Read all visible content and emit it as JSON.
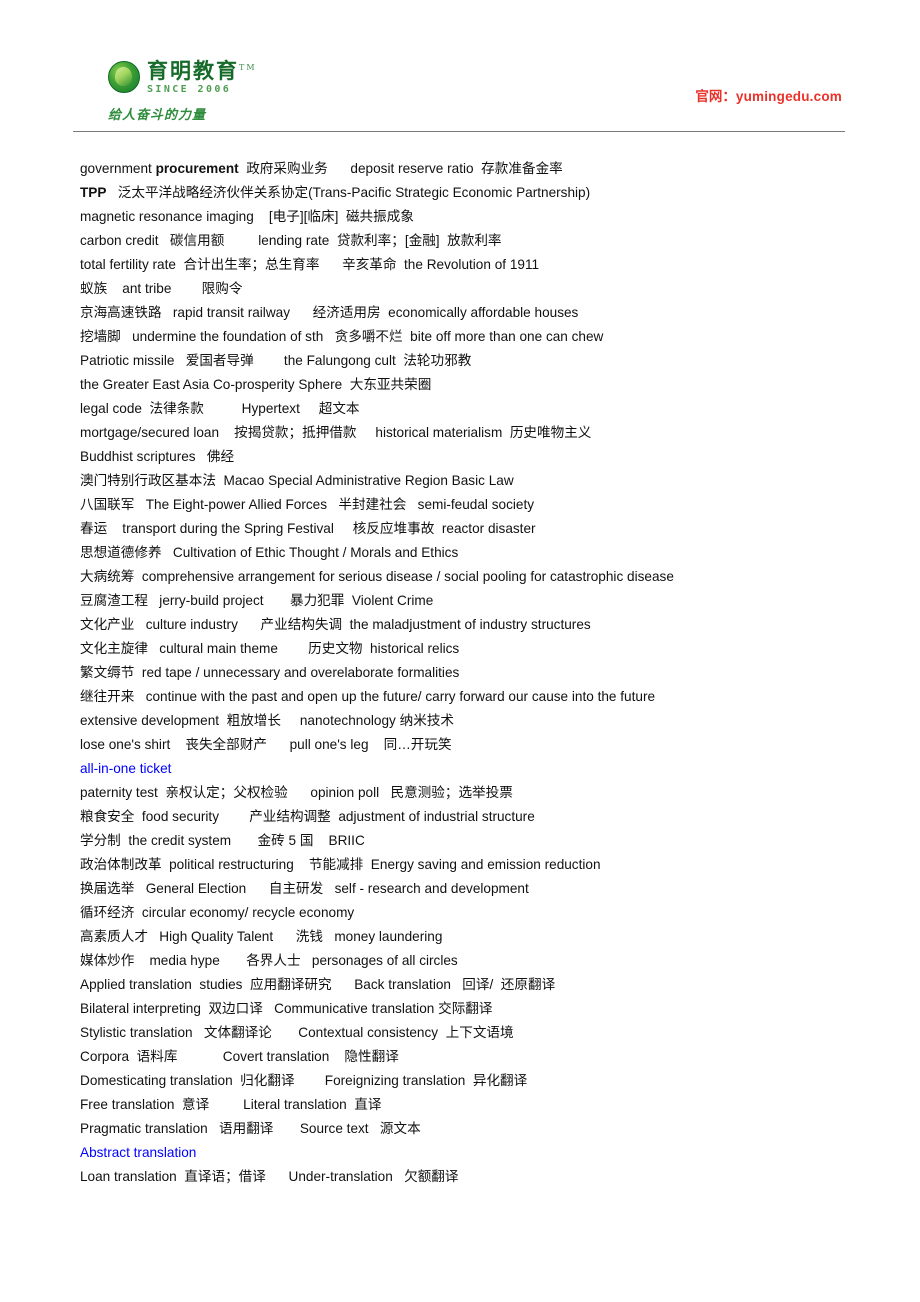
{
  "header": {
    "logo": {
      "brand_cn": "育明教育",
      "trademark": "TM",
      "since": "SINCE 2006",
      "slogan": "给人奋斗的力量"
    },
    "site_label": "官网：",
    "site_url": "yumingedu.com",
    "url_color": "#e8322a",
    "brand_color": "#176b2a"
  },
  "document": {
    "highlight_color": "#0000ff",
    "lines": [
      {
        "id": "line-1",
        "text": "government procurement  政府采购业务      deposit reserve ratio  存款准备金率",
        "bold_spans": [
          "procurement"
        ],
        "color": "default"
      },
      {
        "id": "line-2",
        "text": "TPP   泛太平洋战略经济伙伴关系协定(Trans-Pacific Strategic Economic Partnership)",
        "bold_spans": [
          "TPP"
        ],
        "color": "default"
      },
      {
        "id": "line-3",
        "text": "magnetic resonance imaging    [电子][临床]  磁共振成象",
        "bold_spans": [],
        "color": "default"
      },
      {
        "id": "line-4",
        "text": "carbon credit   碳信用额         lending rate  贷款利率；[金融]  放款利率",
        "bold_spans": [],
        "color": "default"
      },
      {
        "id": "line-5",
        "text": "total fertility rate  合计出生率；总生育率      辛亥革命  the Revolution of 1911",
        "bold_spans": [],
        "color": "default"
      },
      {
        "id": "line-6",
        "text": "蚁族    ant tribe        限购令",
        "bold_spans": [],
        "color": "default",
        "blue_spans": [
          "限购令"
        ]
      },
      {
        "id": "line-7",
        "text": "京海高速铁路   rapid transit railway      经济适用房  economically affordable houses",
        "bold_spans": [],
        "color": "default"
      },
      {
        "id": "line-8",
        "text": "挖墙脚   undermine the foundation of sth   贪多嚼不烂  bite off more than one can chew",
        "bold_spans": [],
        "color": "default"
      },
      {
        "id": "line-9",
        "text": "Patriotic missile   爱国者导弹        the Falungong cult  法轮功邪教",
        "bold_spans": [],
        "color": "default"
      },
      {
        "id": "line-10",
        "text": "the Greater East Asia Co-prosperity Sphere  大东亚共荣圈",
        "bold_spans": [],
        "color": "default"
      },
      {
        "id": "line-11",
        "text": "legal code  法律条款          Hypertext     超文本",
        "bold_spans": [],
        "color": "default"
      },
      {
        "id": "line-12",
        "text": "mortgage/secured loan    按揭贷款；抵押借款     historical materialism  历史唯物主义",
        "bold_spans": [],
        "color": "default"
      },
      {
        "id": "line-13",
        "text": "Buddhist scriptures   佛经",
        "bold_spans": [],
        "color": "default"
      },
      {
        "id": "line-14",
        "text": "澳门特别行政区基本法  Macao Special Administrative Region Basic Law",
        "bold_spans": [],
        "color": "default"
      },
      {
        "id": "line-15",
        "text": "八国联军   The Eight-power Allied Forces   半封建社会   semi-feudal society",
        "bold_spans": [],
        "color": "default"
      },
      {
        "id": "line-16",
        "text": "春运    transport during the Spring Festival     核反应堆事故  reactor disaster",
        "bold_spans": [],
        "color": "default"
      },
      {
        "id": "line-17",
        "text": "思想道德修养   Cultivation of Ethic Thought / Morals and Ethics",
        "bold_spans": [],
        "color": "default"
      },
      {
        "id": "line-18",
        "text": "大病统筹  comprehensive arrangement for serious disease / social pooling for catastrophic disease",
        "bold_spans": [],
        "color": "default"
      },
      {
        "id": "line-19",
        "text": "豆腐渣工程   jerry-build project       暴力犯罪  Violent Crime",
        "bold_spans": [],
        "color": "default"
      },
      {
        "id": "line-20",
        "text": "文化产业   culture industry      产业结构失调  the maladjustment of industry structures",
        "bold_spans": [],
        "color": "default"
      },
      {
        "id": "line-21",
        "text": "文化主旋律   cultural main theme        历史文物  historical relics",
        "bold_spans": [],
        "color": "default"
      },
      {
        "id": "line-22",
        "text": "繁文缛节  red tape / unnecessary and overelaborate formalities",
        "bold_spans": [],
        "color": "default"
      },
      {
        "id": "line-23",
        "text": "继往开来   continue with the past and open up the future/ carry forward our cause into the future",
        "bold_spans": [],
        "color": "default"
      },
      {
        "id": "line-24",
        "text": "extensive development  粗放增长     nanotechnology 纳米技术",
        "bold_spans": [],
        "color": "default"
      },
      {
        "id": "line-25",
        "text": "lose one's shirt    丧失全部财产      pull one's leg    同…开玩笑",
        "bold_spans": [],
        "color": "default"
      },
      {
        "id": "line-26",
        "text": "all-in-one ticket",
        "bold_spans": [],
        "color": "blue"
      },
      {
        "id": "line-27",
        "text": "paternity test  亲权认定；父权检验      opinion poll   民意测验；选举投票",
        "bold_spans": [],
        "color": "default"
      },
      {
        "id": "line-28",
        "text": "粮食安全  food security        产业结构调整  adjustment of industrial structure",
        "bold_spans": [],
        "color": "default"
      },
      {
        "id": "line-29",
        "text": "学分制  the credit system       金砖 5 国    BRIIC",
        "bold_spans": [],
        "color": "default"
      },
      {
        "id": "line-30",
        "text": "政治体制改革  political restructuring    节能减排  Energy saving and emission reduction",
        "bold_spans": [],
        "color": "default"
      },
      {
        "id": "line-31",
        "text": "换届选举   General Election      自主研发   self - research and development",
        "bold_spans": [],
        "color": "default"
      },
      {
        "id": "line-32",
        "text": "循环经济  circular economy/ recycle economy",
        "bold_spans": [],
        "color": "default"
      },
      {
        "id": "line-33",
        "text": "高素质人才   High Quality Talent      洗钱   money laundering",
        "bold_spans": [],
        "color": "default"
      },
      {
        "id": "line-34",
        "text": "媒体炒作    media hype       各界人士   personages of all circles",
        "bold_spans": [],
        "color": "default"
      },
      {
        "id": "line-35",
        "text": "Applied translation  studies  应用翻译研究      Back translation   回译/  还原翻译",
        "bold_spans": [],
        "color": "default"
      },
      {
        "id": "line-36",
        "text": "Bilateral interpreting  双边口译   Communicative translation 交际翻译",
        "bold_spans": [],
        "color": "default"
      },
      {
        "id": "line-37",
        "text": "Stylistic translation   文体翻译论       Contextual consistency  上下文语境",
        "bold_spans": [],
        "color": "default"
      },
      {
        "id": "line-38",
        "text": "Corpora  语料库            Covert translation    隐性翻译",
        "bold_spans": [],
        "color": "default"
      },
      {
        "id": "line-39",
        "text": "Domesticating translation  归化翻译        Foreignizing translation  异化翻译",
        "bold_spans": [],
        "color": "default"
      },
      {
        "id": "line-40",
        "text": "Free translation  意译         Literal translation  直译",
        "bold_spans": [],
        "color": "default"
      },
      {
        "id": "line-41",
        "text": "Pragmatic translation   语用翻译       Source text   源文本",
        "bold_spans": [],
        "color": "default"
      },
      {
        "id": "line-42",
        "text": "Abstract translation",
        "bold_spans": [],
        "color": "blue"
      },
      {
        "id": "line-43",
        "text": "Loan translation  直译语；借译      Under-translation   欠额翻译",
        "bold_spans": [],
        "color": "default"
      }
    ]
  }
}
